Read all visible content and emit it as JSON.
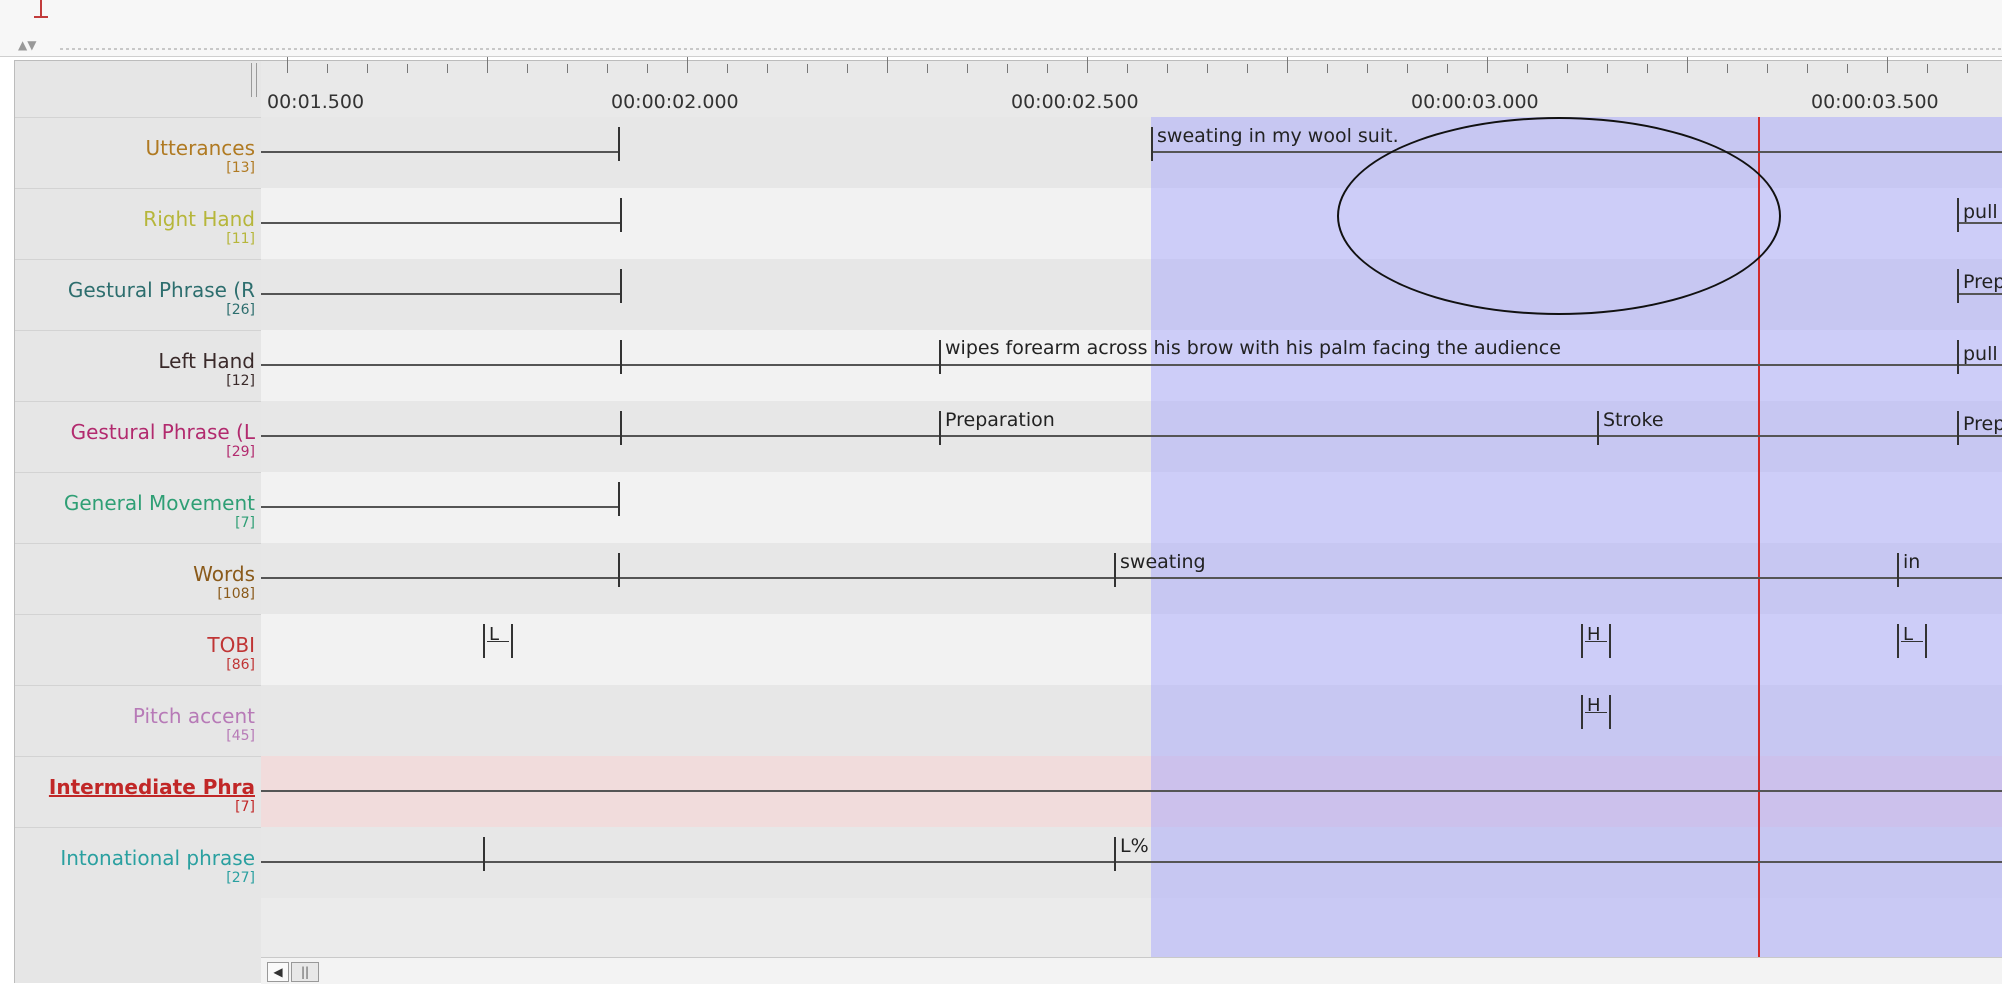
{
  "ruler": {
    "times": [
      "00:01.500",
      "00:00:02.000",
      "00:00:02.500",
      "00:00:03.000",
      "00:00:03.500"
    ]
  },
  "tiers": [
    {
      "name": "Utterances",
      "count": "[13]",
      "color": "#b07a22"
    },
    {
      "name": "Right Hand",
      "count": "[11]",
      "color": "#b6b63a"
    },
    {
      "name": "Gestural Phrase (R",
      "count": "[26]",
      "color": "#2d6e6e"
    },
    {
      "name": "Left Hand",
      "count": "[12]",
      "color": "#3a2a2a"
    },
    {
      "name": "Gestural Phrase (L",
      "count": "[29]",
      "color": "#b22a6e"
    },
    {
      "name": "General Movement",
      "count": "[7]",
      "color": "#2f9f75"
    },
    {
      "name": "Words",
      "count": "[108]",
      "color": "#8a5a1a"
    },
    {
      "name": "TOBI",
      "count": "[86]",
      "color": "#c03535"
    },
    {
      "name": "Pitch accent",
      "count": "[45]",
      "color": "#b77ab7"
    },
    {
      "name": "Intermediate Phra",
      "count": "[7]",
      "color": "#c12727"
    },
    {
      "name": "Intonational phrase",
      "count": "[27]",
      "color": "#2aa0a0"
    }
  ],
  "annotations": {
    "utterance": "sweating in my wool suit.",
    "right_hand": "pull",
    "gestural_r": "Prep",
    "left_hand_1": "wipes forearm across his brow with his palm facing the audience",
    "left_hand_2": "pull",
    "gestural_l_1": "Preparation",
    "gestural_l_2": "Stroke",
    "gestural_l_3": "Prep",
    "words_1": "sweating",
    "words_2": "in",
    "tobi_1": "L",
    "tobi_2": "H",
    "tobi_3": "L",
    "pitch_accent": "H",
    "intonational": "L%"
  },
  "scroll": {
    "left_icon": "scroll-left-arrow",
    "thumb_icon": "grip-lines"
  },
  "colors": {
    "selection": "#a0a0ff",
    "cursor": "#d22b2b",
    "active_tier": "#f1dcdc"
  }
}
